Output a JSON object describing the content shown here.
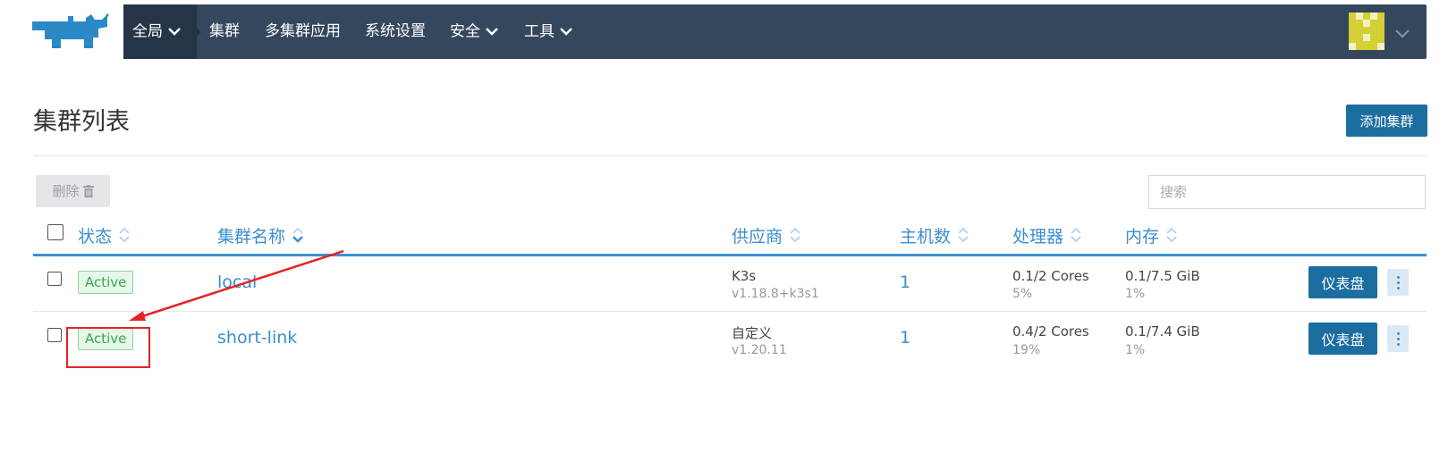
{
  "nav": {
    "global": "全局",
    "clusters": "集群",
    "multi_cluster_apps": "多集群应用",
    "system_settings": "系统设置",
    "security": "安全",
    "tools": "工具"
  },
  "page": {
    "title": "集群列表",
    "add_cluster": "添加集群",
    "delete": "删除",
    "search_placeholder": "搜索"
  },
  "table": {
    "headers": {
      "status": "状态",
      "name": "集群名称",
      "provider": "供应商",
      "nodes": "主机数",
      "cpu": "处理器",
      "memory": "内存"
    },
    "rows": [
      {
        "status": "Active",
        "name": "local",
        "provider": "K3s",
        "version": "v1.18.8+k3s1",
        "nodes": "1",
        "cpu": "0.1/2 Cores",
        "cpu_pct": "5%",
        "memory": "0.1/7.5 GiB",
        "memory_pct": "1%",
        "action": "仪表盘"
      },
      {
        "status": "Active",
        "name": "short-link",
        "provider": "自定义",
        "version": "v1.20.11",
        "nodes": "1",
        "cpu": "0.4/2 Cores",
        "cpu_pct": "19%",
        "memory": "0.1/7.4 GiB",
        "memory_pct": "1%",
        "action": "仪表盘"
      }
    ]
  },
  "colors": {
    "navbar": "#34475d",
    "accent": "#3a8ed1",
    "primary_button": "#1c6ea0",
    "active_badge": "#3aa74d",
    "annotation": "#e32424"
  }
}
